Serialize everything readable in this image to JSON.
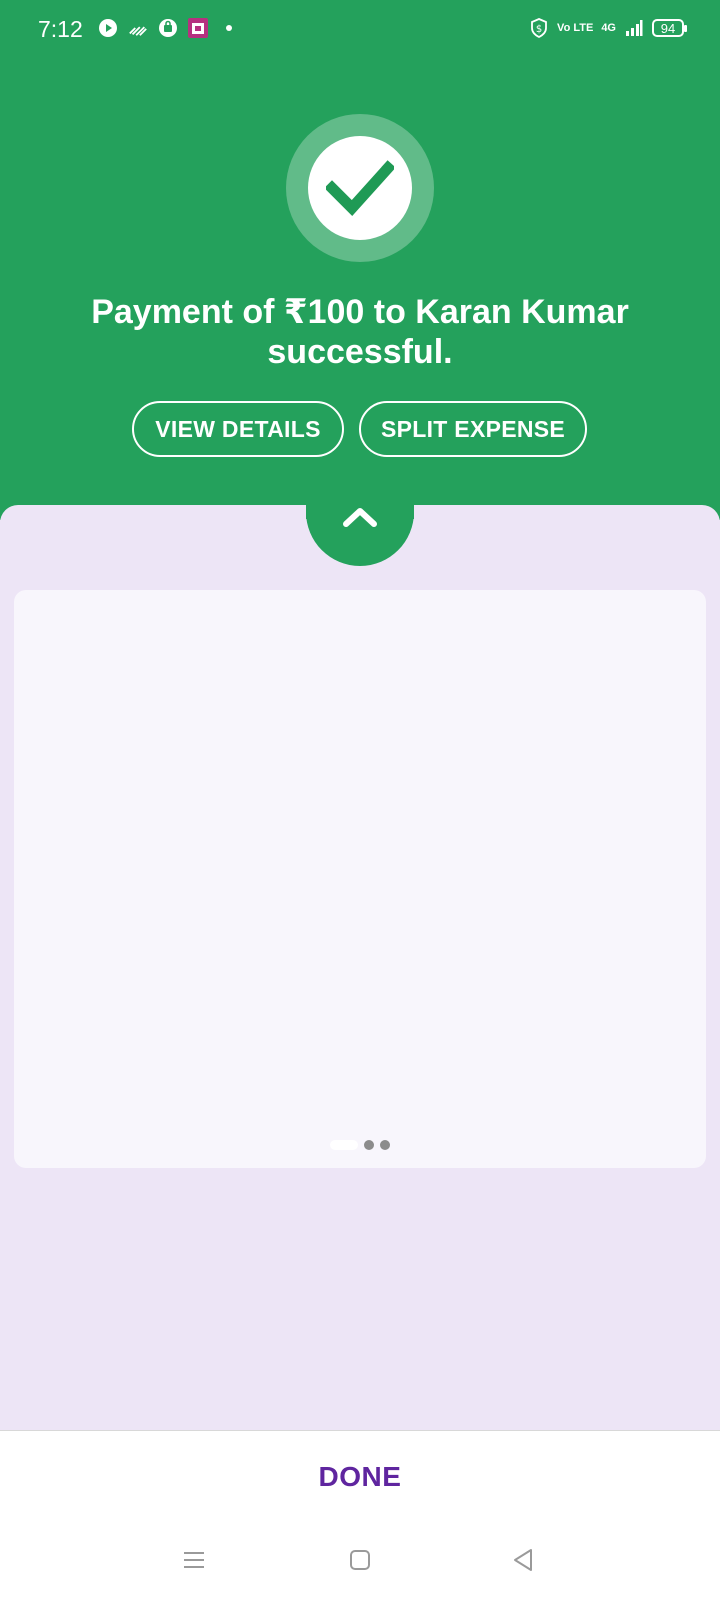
{
  "status_bar": {
    "time": "7:12",
    "network": "4G",
    "volte": "Vo LTE",
    "battery": "94",
    "left_icons": [
      "play-icon",
      "signal-waves-icon",
      "bag-icon",
      "calendar-icon",
      "dot-icon"
    ],
    "right_icons": [
      "shield-dollar-icon",
      "volte-icon",
      "cellular-signal-icon",
      "battery-icon"
    ]
  },
  "success": {
    "message": "Payment of ₹100 to Karan Kumar successful.",
    "view_details_label": "VIEW DETAILS",
    "split_expense_label": "SPLIT EXPENSE"
  },
  "carousel": {
    "total_pages": 3,
    "active_page": 1
  },
  "footer": {
    "done_label": "DONE"
  },
  "colors": {
    "header_green": "#24a15c",
    "sheet_bg": "#ede5f6",
    "done_purple": "#5f259f",
    "check_green": "#1f9a55"
  }
}
